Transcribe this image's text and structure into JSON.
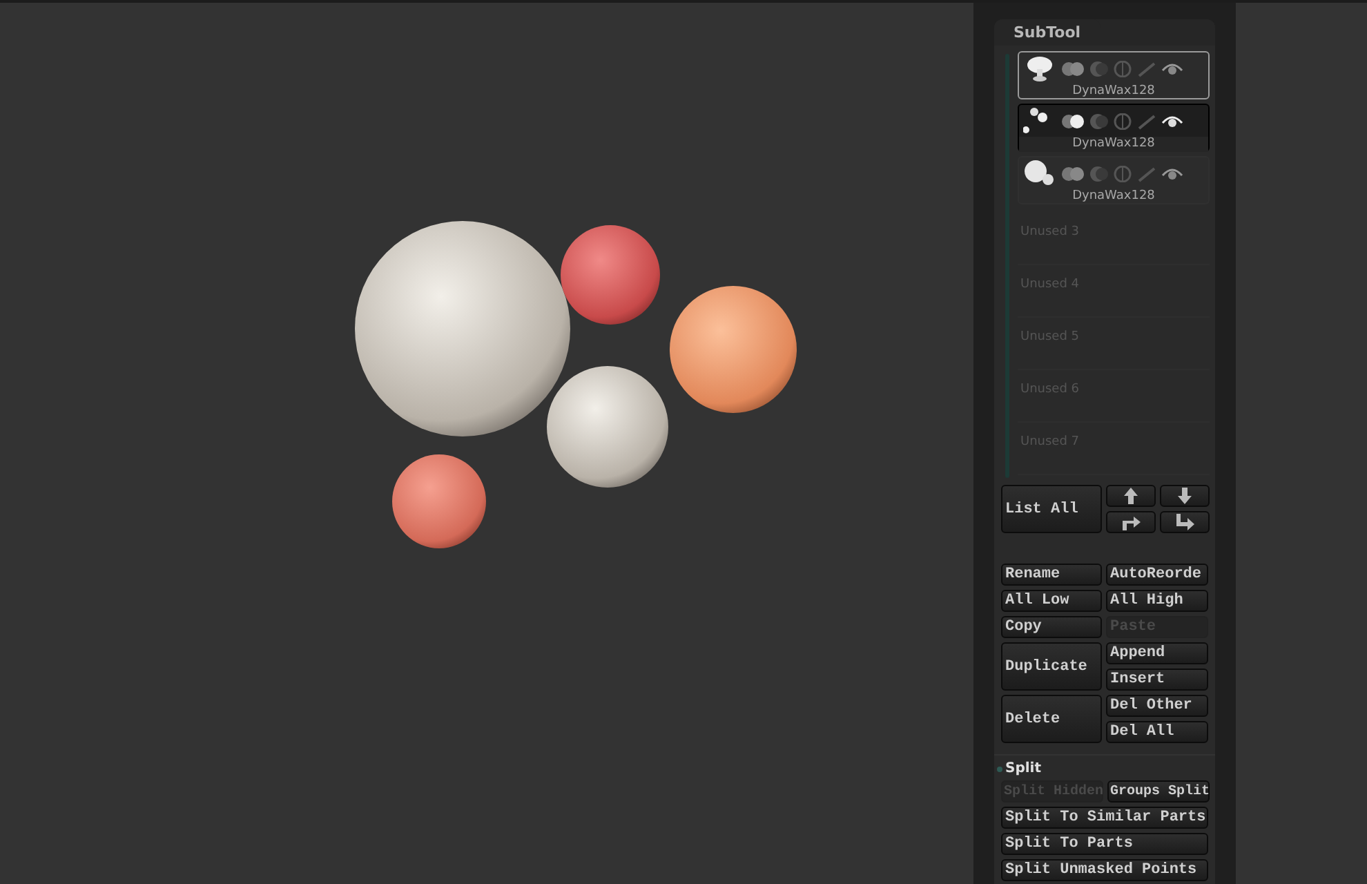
{
  "subtool": {
    "title": "SubTool",
    "items": [
      {
        "name": "DynaWax128",
        "selected": true,
        "highlighted": false,
        "visible": true
      },
      {
        "name": "DynaWax128",
        "selected": false,
        "highlighted": true,
        "visible": true
      },
      {
        "name": "DynaWax128",
        "selected": false,
        "highlighted": false,
        "visible": true
      }
    ],
    "unused_slots": [
      "Unused  3",
      "Unused  4",
      "Unused  5",
      "Unused  6",
      "Unused  7"
    ],
    "list_all": "List All",
    "button_groups": [
      {
        "left": {
          "label": "Rename",
          "disabled": false
        },
        "right": [
          {
            "label": "AutoReorde",
            "disabled": false
          }
        ]
      },
      {
        "left": {
          "label": "All Low",
          "disabled": false
        },
        "right": [
          {
            "label": "All High",
            "disabled": false
          }
        ]
      },
      {
        "left": {
          "label": "Copy",
          "disabled": false
        },
        "right": [
          {
            "label": "Paste",
            "disabled": true
          }
        ]
      },
      {
        "left": {
          "label": "Duplicate",
          "disabled": false
        },
        "right": [
          {
            "label": "Append",
            "disabled": false
          },
          {
            "label": "Insert",
            "disabled": false
          }
        ]
      },
      {
        "left": {
          "label": "Delete",
          "disabled": false
        },
        "right": [
          {
            "label": "Del Other",
            "disabled": false
          },
          {
            "label": "Del All",
            "disabled": false
          }
        ]
      }
    ]
  },
  "split": {
    "title": "Split",
    "pair": [
      {
        "label": "Split Hidden",
        "disabled": true
      },
      {
        "label": "Groups Split",
        "disabled": false
      }
    ],
    "buttons": [
      {
        "label": "Split To Similar Parts",
        "disabled": false
      },
      {
        "label": "Split To Parts",
        "disabled": false
      },
      {
        "label": "Split Unmasked Points",
        "disabled": false
      }
    ]
  }
}
